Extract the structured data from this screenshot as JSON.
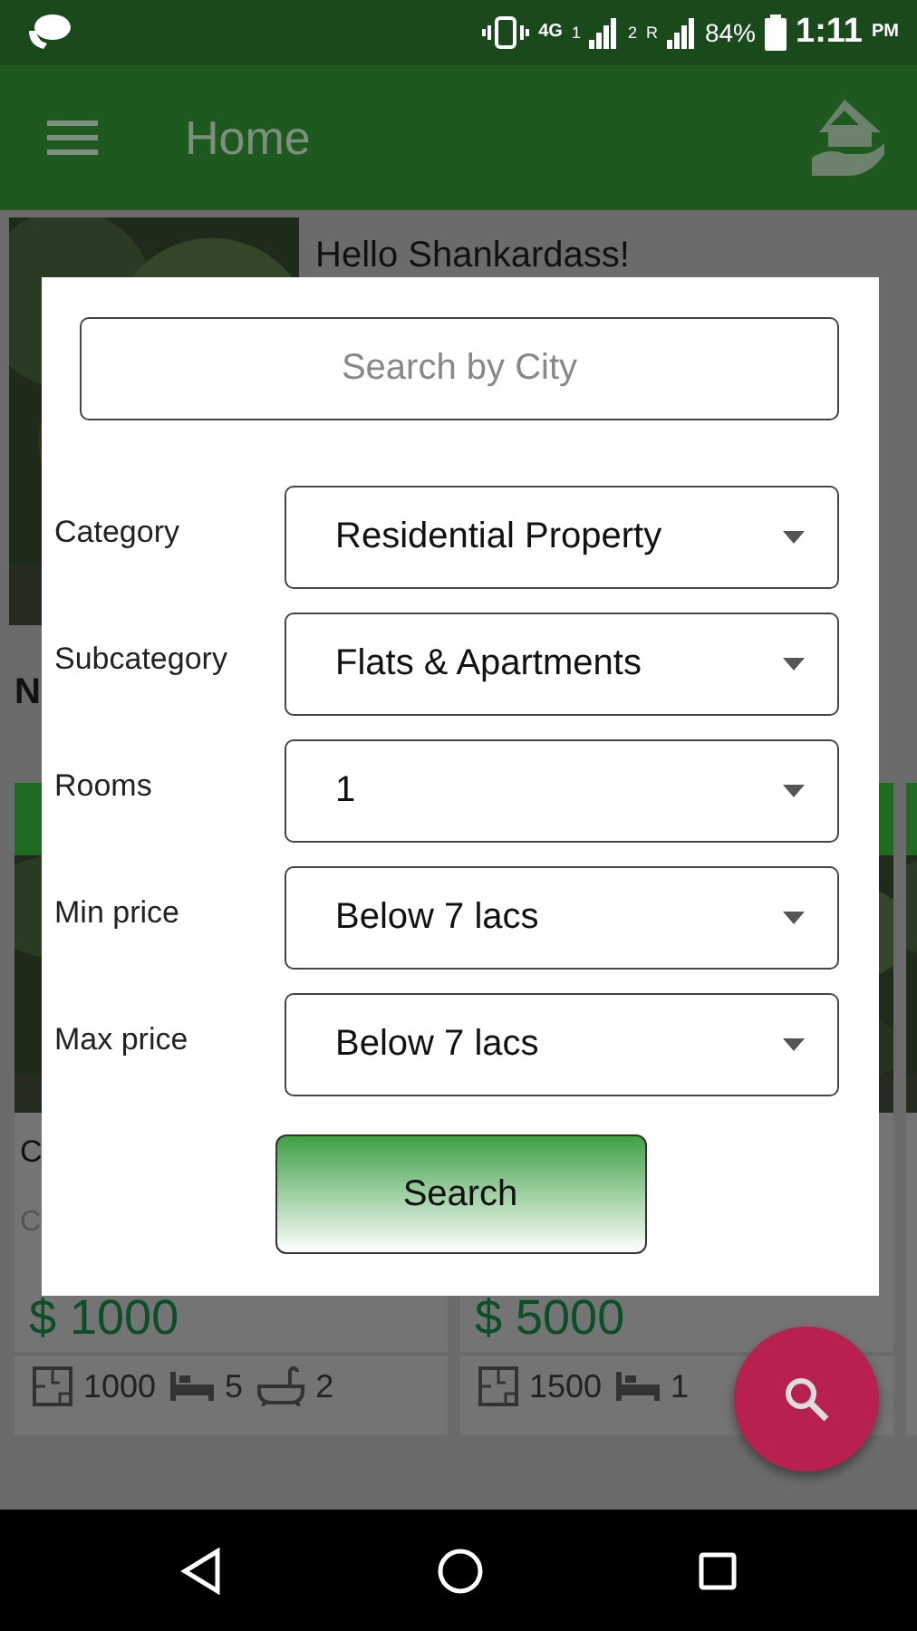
{
  "status_bar": {
    "network": "4G",
    "sim_1": "1",
    "sim_2": "2",
    "roaming": "R",
    "battery": "84%",
    "time": "1:11",
    "time_suffix": "PM"
  },
  "app_bar": {
    "title": "Home"
  },
  "greeting": "Hello  Shankardass!",
  "section_heading": "N",
  "listings": [
    {
      "kind": "full",
      "title": "C",
      "subtitle": "C",
      "price": "$ 1000",
      "features": [
        {
          "kind": "area",
          "value": "1000"
        },
        {
          "kind": "bed",
          "value": "5"
        },
        {
          "kind": "bath",
          "value": "2"
        }
      ]
    },
    {
      "kind": "full",
      "price": "$ 5000",
      "features": [
        {
          "kind": "area",
          "value": "1500"
        },
        {
          "kind": "bed",
          "value": "1"
        }
      ]
    },
    {
      "kind": "partial"
    }
  ],
  "dialog": {
    "search": {
      "placeholder": "Search by City"
    },
    "filters": [
      {
        "label": "Category",
        "value": "Residential Property"
      },
      {
        "label": "Subcategory",
        "value": "Flats & Apartments"
      },
      {
        "label": "Rooms",
        "value": "1"
      },
      {
        "label": "Min price",
        "value": "Below 7 lacs"
      },
      {
        "label": "Max price",
        "value": "Below 7 lacs"
      }
    ],
    "button": "Search"
  }
}
